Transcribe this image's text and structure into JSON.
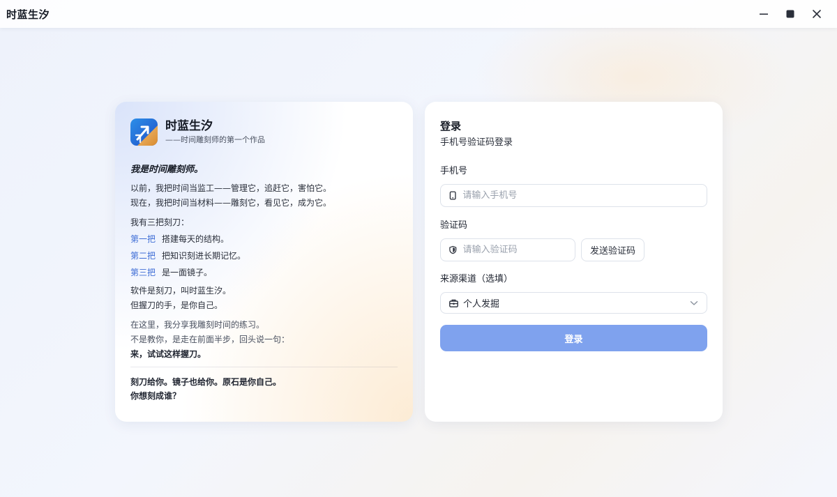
{
  "window": {
    "title": "时蓝生汐",
    "controls": {
      "minimize": "minimize-icon",
      "maximize": "maximize-icon",
      "close": "close-icon"
    }
  },
  "brand": {
    "name": "时蓝生汐",
    "tagline": "——时间雕刻师的第一个作品",
    "colors": {
      "blue": "#2f6fe0",
      "gold": "#e3a54a"
    }
  },
  "story": {
    "heading": "我是时间雕刻师。",
    "past_line": "以前，我把时间当监工——管理它，追赶它，害怕它。",
    "now_line": "现在，我把时间当材料——雕刻它，看见它，成为它。",
    "three_knives_intro": "我有三把刻刀：",
    "knives": [
      {
        "tag": "第一把",
        "text": "搭建每天的结构。"
      },
      {
        "tag": "第二把",
        "text": "把知识刻进长期记忆。"
      },
      {
        "tag": "第三把",
        "text": "是一面镜子。"
      }
    ],
    "software_line1": "软件是刻刀，叫时蓝生汐。",
    "software_line2": "但握刀的手，是你自己。",
    "share_line1": "在这里，我分享我雕刻时间的练习。",
    "share_line2": "不是教你，是走在前面半步，回头说一句：",
    "share_line3": "来，试试这样握刀。",
    "closing_line1": "刻刀给你。镜子也给你。原石是你自己。",
    "closing_line2": "你想刻成谁？"
  },
  "login": {
    "title": "登录",
    "subtitle": "手机号验证码登录",
    "phone_label": "手机号",
    "phone_placeholder": "请输入手机号",
    "phone_value": "",
    "code_label": "验证码",
    "code_placeholder": "请输入验证码",
    "code_value": "",
    "send_code": "发送验证码",
    "source_label": "来源渠道（选填）",
    "source_selected": "个人发掘",
    "submit": "登录",
    "accent": "#7fa2ee"
  }
}
